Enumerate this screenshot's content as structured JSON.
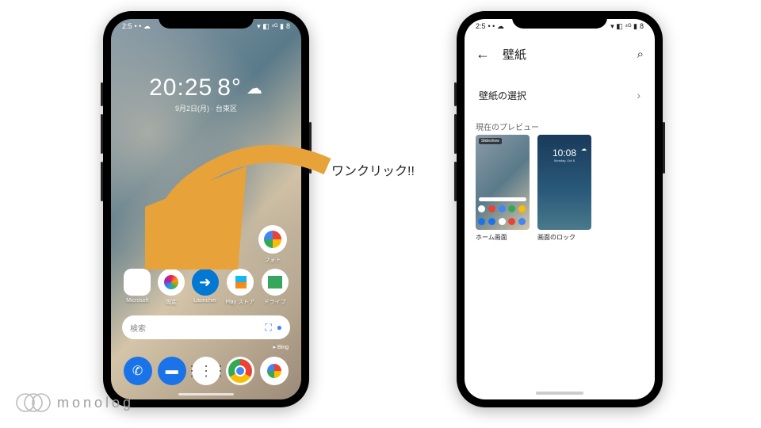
{
  "annotation": {
    "text": "ワンクリック!!"
  },
  "logo": {
    "text": "monolog"
  },
  "phone_left": {
    "status": {
      "time_fragment": "2:5",
      "battery": "8"
    },
    "clock": {
      "time": "20:25",
      "temp": "8°",
      "date": "9月2日(月) · 台東区"
    },
    "apps": {
      "photos": "フォト",
      "row": [
        {
          "label": "Microsoft"
        },
        {
          "label": "設定"
        },
        {
          "label": "Launcher"
        },
        {
          "label": "Play ストア"
        },
        {
          "label": "ドライブ"
        }
      ]
    },
    "search": {
      "placeholder": "検索",
      "provider": "Bing"
    }
  },
  "phone_right": {
    "status": {
      "time_fragment": "2:5",
      "battery": "8"
    },
    "header": {
      "title": "壁紙"
    },
    "section": {
      "label": "壁紙の選択"
    },
    "preview": {
      "label": "現在のプレビュー",
      "home": {
        "label": "ホーム画面",
        "badge": "Slideshow"
      },
      "lock": {
        "label": "画面のロック",
        "time": "10:08",
        "date": "Monday, Oct 8"
      }
    }
  }
}
